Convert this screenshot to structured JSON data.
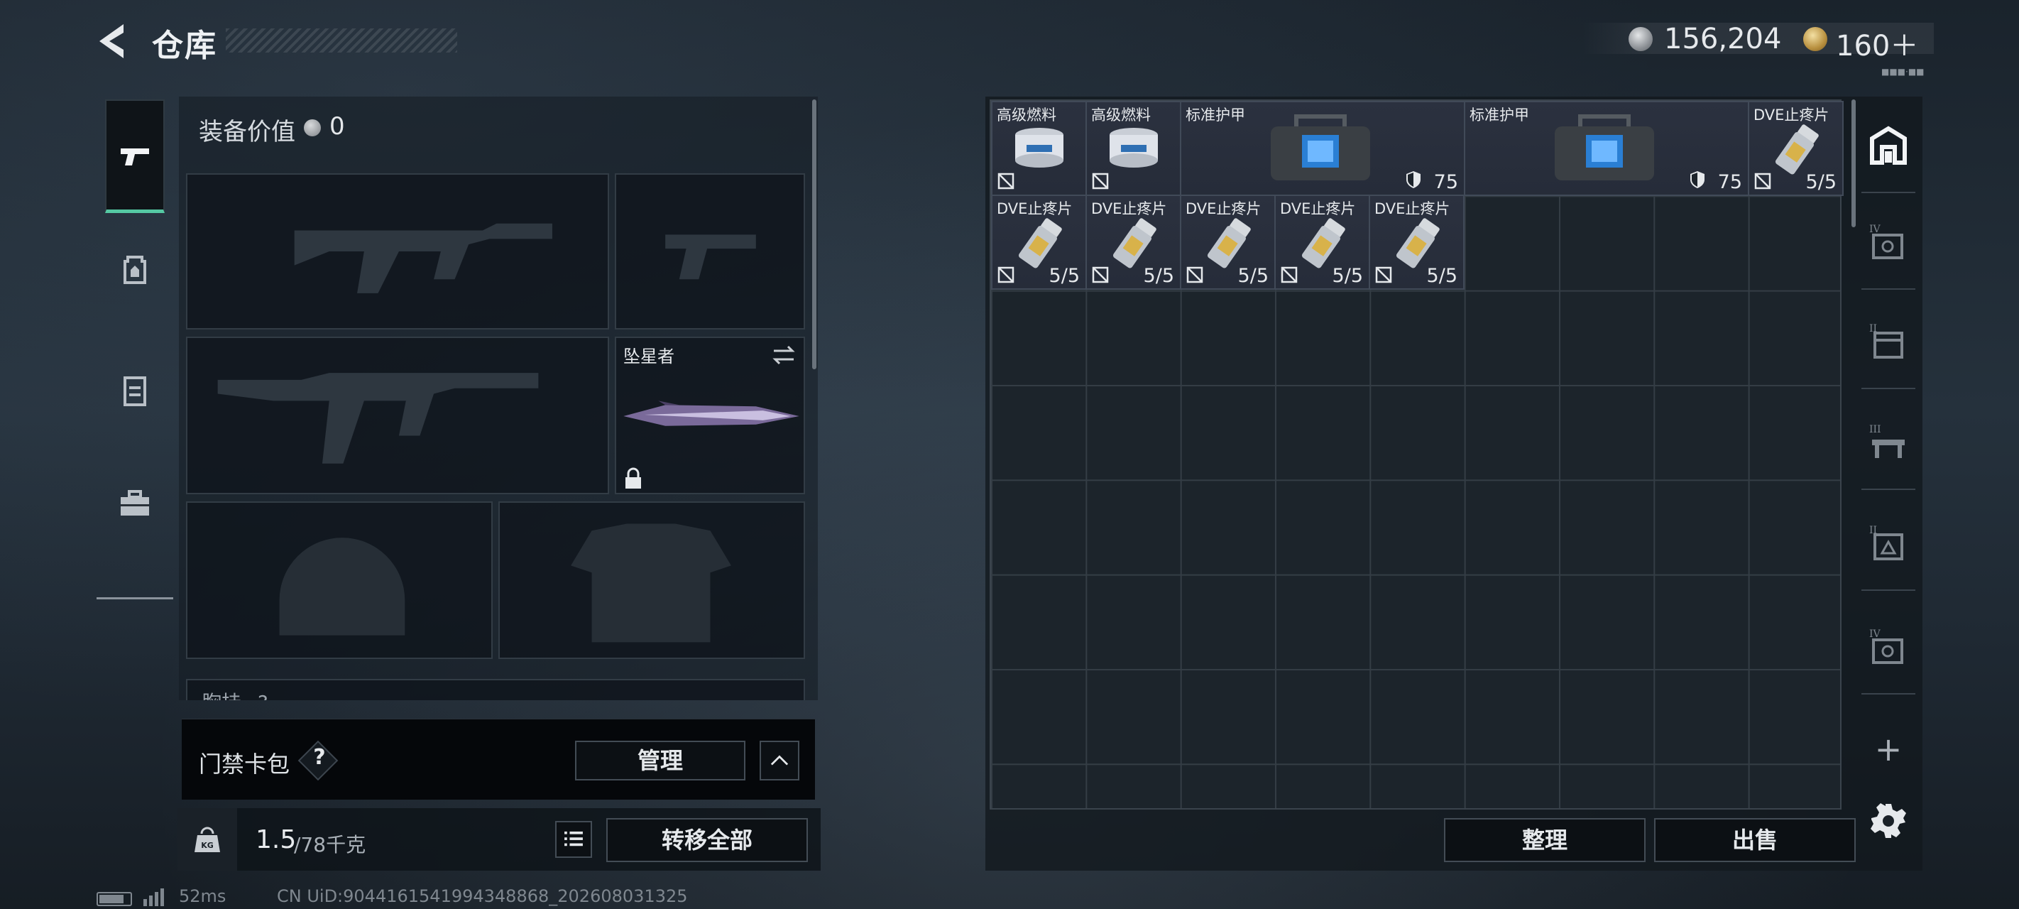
{
  "header": {
    "title": "仓库",
    "silver_amount": "156,204",
    "gold_amount": "160＋",
    "corner_label": "■■■·■■"
  },
  "left_tabs": [
    {
      "name": "weapons",
      "icon": "pistol-icon",
      "active": true
    },
    {
      "name": "backpack",
      "icon": "backpack-icon",
      "active": false
    },
    {
      "name": "rig",
      "icon": "chest-rig-icon",
      "active": false
    },
    {
      "name": "case",
      "icon": "briefcase-icon",
      "active": false
    }
  ],
  "equipment": {
    "value_label": "装备价值",
    "value": "0",
    "melee_name": "坠星者",
    "chest_label": "胸挂",
    "chest_badge": "?"
  },
  "keycard": {
    "label": "门禁卡包",
    "help": "?",
    "manage_label": "管理"
  },
  "weight": {
    "icon": "KG",
    "current": "1.5",
    "max": "/78千克",
    "transfer_label": "转移全部"
  },
  "stash": {
    "items": [
      {
        "name": "高级燃料",
        "stat": "",
        "kind": "fuel"
      },
      {
        "name": "高级燃料",
        "stat": "",
        "kind": "fuel"
      },
      {
        "name": "标准护甲",
        "stat": "75",
        "kind": "armor"
      },
      {
        "name": "标准护甲",
        "stat": "75",
        "kind": "armor"
      },
      {
        "name": "DVE止疼片",
        "stat": "5/5",
        "kind": "pills"
      },
      {
        "name": "DVE止疼片",
        "stat": "5/5",
        "kind": "pills"
      },
      {
        "name": "DVE止疼片",
        "stat": "5/5",
        "kind": "pills"
      },
      {
        "name": "DVE止疼片",
        "stat": "5/5",
        "kind": "pills"
      },
      {
        "name": "DVE止疼片",
        "stat": "5/5",
        "kind": "pills"
      },
      {
        "name": "DVE止疼片",
        "stat": "5/5",
        "kind": "pills"
      }
    ],
    "sort_label": "整理",
    "sell_label": "出售"
  },
  "right_tabs": [
    {
      "name": "main-stash",
      "icon": "stash-icon",
      "tier": ""
    },
    {
      "name": "stash-tier-iv-a",
      "icon": "safe-box-icon",
      "tier": "IV"
    },
    {
      "name": "stash-tier-ii",
      "icon": "crate-icon",
      "tier": "II"
    },
    {
      "name": "stash-tier-iii",
      "icon": "workbench-icon",
      "tier": "III"
    },
    {
      "name": "stash-tier-ii-b",
      "icon": "gear-box-icon",
      "tier": "II"
    },
    {
      "name": "stash-tier-iv-b",
      "icon": "safe-box-icon",
      "tier": "IV"
    }
  ],
  "right_add": "+",
  "footer": {
    "ping": "52ms",
    "uid": "CN UiD:9044161541994348868_202608031325"
  },
  "colors": {
    "accent_green": "#55c9a3",
    "item_bg": "#2b313f",
    "button_bg": "#0c1014"
  }
}
